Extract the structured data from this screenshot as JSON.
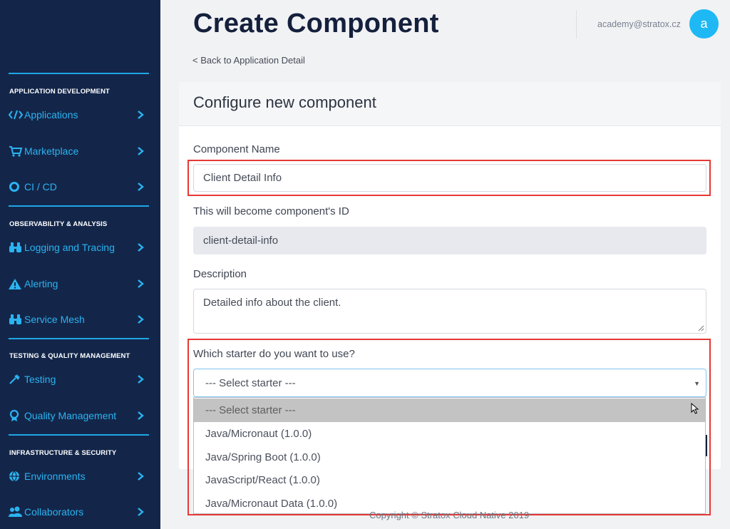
{
  "sidebar": {
    "logo_text": "",
    "sections": [
      {
        "title": "APPLICATION DEVELOPMENT"
      },
      {
        "title": "OBSERVABILITY & ANALYSIS"
      },
      {
        "title": "TESTING & QUALITY MANAGEMENT"
      },
      {
        "title": "INFRASTRUCTURE & SECURITY"
      }
    ],
    "items": [
      {
        "label": "Applications",
        "icon": "code-icon"
      },
      {
        "label": "Marketplace",
        "icon": "cart-icon"
      },
      {
        "label": "CI / CD",
        "icon": "ring-icon"
      },
      {
        "label": "Logging and Tracing",
        "icon": "binoculars-icon"
      },
      {
        "label": "Alerting",
        "icon": "warning-icon"
      },
      {
        "label": "Service Mesh",
        "icon": "binoculars-icon"
      },
      {
        "label": "Testing",
        "icon": "pipette-icon"
      },
      {
        "label": "Quality Management",
        "icon": "award-icon"
      },
      {
        "label": "Environments",
        "icon": "globe-icon"
      },
      {
        "label": "Collaborators",
        "icon": "users-icon"
      }
    ]
  },
  "header": {
    "title": "Create Component",
    "email": "academy@stratox.cz",
    "avatar_initial": "a",
    "back_link": "< Back to Application Detail"
  },
  "form": {
    "card_title": "Configure new component",
    "name_label": "Component Name",
    "name_value": "Client Detail Info",
    "id_label": "This will become component's ID",
    "id_value": "client-detail-info",
    "description_label": "Description",
    "description_value": "Detailed info about the client.",
    "starter_label": "Which starter do you want to use?",
    "starter_selected": "--- Select starter ---",
    "starter_options": [
      "--- Select starter ---",
      "Java/Micronaut (1.0.0)",
      "Java/Spring Boot (1.0.0)",
      "JavaScript/React (1.0.0)",
      "Java/Micronaut Data (1.0.0)"
    ]
  },
  "footer": {
    "copyright": "Copyright © Stratox Cloud Native 2019"
  },
  "colors": {
    "sidebar_bg": "#13264a",
    "accent": "#2bb3f0",
    "highlight": "#e53935",
    "title": "#14203c"
  }
}
